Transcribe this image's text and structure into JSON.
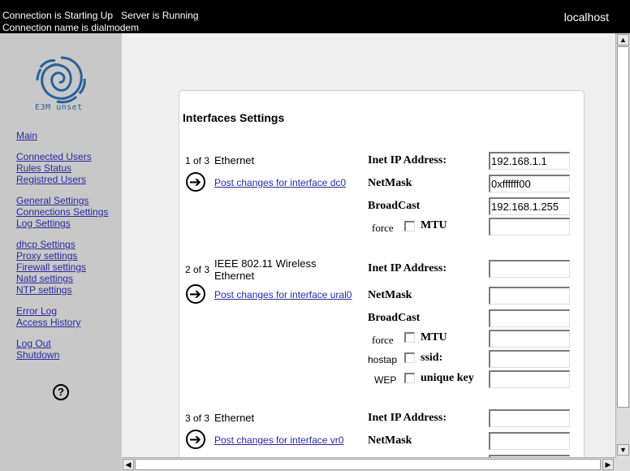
{
  "status": {
    "line1": "Connection is Starting Up   Server is Running",
    "line2": "Connection name is dialmodem",
    "host": "localhost"
  },
  "sidebar": {
    "logo_text": "E3M unset",
    "links": [
      "Main",
      "Connected Users",
      "Rules Status",
      "Registred Users",
      "General Settings",
      "Connections Settings",
      "Log Settings",
      "dhcp Settings",
      "Proxy settings",
      "Firewall settings",
      "Natd settings",
      "NTP settings",
      "Error Log",
      "Access History",
      "Log Out",
      "Shutdown"
    ],
    "help": "?"
  },
  "panel": {
    "title": "Interfaces Settings",
    "labels": {
      "ip": "Inet IP Address:",
      "netmask": "NetMask",
      "broadcast": "BroadCast",
      "force": "force",
      "mtu": "MTU",
      "hostap": "hostap",
      "ssid": "ssid:",
      "wep": "WEP",
      "unique_key": "unique key"
    },
    "interfaces": [
      {
        "count": "1 of 3",
        "name": "Ethernet",
        "post": "Post changes for interface dc0",
        "ip": "192.168.1.1",
        "netmask": "0xffffff00",
        "broadcast": "192.168.1.255",
        "mtu": ""
      },
      {
        "count": "2 of 3",
        "name": "IEEE 802.11 Wireless Ethernet",
        "post": "Post changes for interface ural0",
        "ip": "",
        "netmask": "",
        "broadcast": "",
        "mtu": "",
        "ssid": "",
        "unique_key": ""
      },
      {
        "count": "3 of 3",
        "name": "Ethernet",
        "post": "Post changes for interface vr0",
        "ip": "",
        "netmask": ""
      }
    ]
  }
}
